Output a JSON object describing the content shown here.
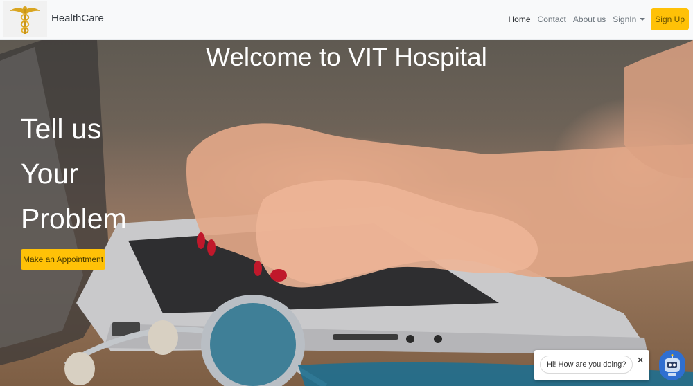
{
  "navbar": {
    "logo_icon": "caduceus-icon",
    "brand": "HealthCare",
    "links": [
      {
        "label": "Home",
        "active": true
      },
      {
        "label": "Contact",
        "active": false
      },
      {
        "label": "About us",
        "active": false
      }
    ],
    "signin_label": "SignIn",
    "signup_label": "Sign Up"
  },
  "hero": {
    "title": "Welcome to VIT Hospital",
    "tagline_lines": [
      "Tell us",
      "Your",
      "Problem"
    ],
    "appointment_label": "Make an Appointment"
  },
  "chat": {
    "greeting": "Hi! How are you doing?",
    "close_glyph": "×",
    "launcher_icon": "robot-icon"
  },
  "colors": {
    "accent": "#ffc107",
    "navbar_bg": "#f8f9fa",
    "chat_launcher": "#2f6fd1"
  }
}
